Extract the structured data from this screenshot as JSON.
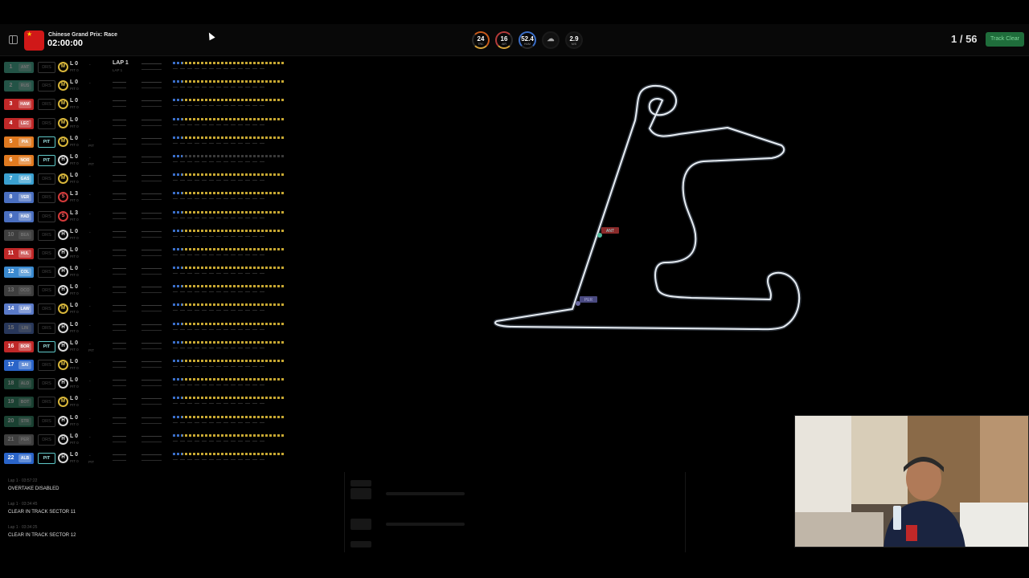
{
  "header": {
    "race_name": "Chinese Grand Prix: Race",
    "clock": "02:00:00",
    "lap_current": "1",
    "lap_total": "56",
    "lap_text": "1 / 56",
    "track_status": "Track Clear",
    "flag_icon": "china-flag-icon"
  },
  "weather": [
    {
      "value": "24",
      "label": "TRC"
    },
    {
      "value": "16",
      "label": "AIR"
    },
    {
      "value": "52.4",
      "label": "HUM"
    },
    {
      "value": "",
      "label": "RAIN",
      "icon": "rain-cloud-icon"
    },
    {
      "value": "2.9",
      "label": "M/S"
    }
  ],
  "lap_header": {
    "title": "LAP 1",
    "sub": "LAP 1"
  },
  "drivers": [
    {
      "pos": "1",
      "code": "ANT",
      "color": "#4fb89b",
      "dim": true,
      "drs": "DRS",
      "tyre": "M",
      "laps": "L 0",
      "pit": "PIT 0"
    },
    {
      "pos": "2",
      "code": "RUS",
      "color": "#4fb89b",
      "dim": true,
      "drs": "DRS",
      "tyre": "M",
      "laps": "L 0",
      "pit": "PIT 0"
    },
    {
      "pos": "3",
      "code": "HAM",
      "color": "#c02828",
      "dim": false,
      "drs": "DRS",
      "tyre": "M",
      "laps": "L 0",
      "pit": "PIT 0"
    },
    {
      "pos": "4",
      "code": "LEC",
      "color": "#c02828",
      "dim": false,
      "drs": "DRS",
      "tyre": "M",
      "laps": "L 0",
      "pit": "PIT 0"
    },
    {
      "pos": "5",
      "code": "PIA",
      "color": "#e07a20",
      "dim": false,
      "drs": "PIT",
      "tyre": "M",
      "laps": "L 0",
      "pit": "PIT 0",
      "pittag": "PIT"
    },
    {
      "pos": "6",
      "code": "NOR",
      "color": "#e07a20",
      "dim": false,
      "drs": "PIT",
      "tyre": "H",
      "laps": "L 0",
      "pit": "PIT 0",
      "pittag": "PIT"
    },
    {
      "pos": "7",
      "code": "GAS",
      "color": "#3aa0d0",
      "dim": false,
      "drs": "DRS",
      "tyre": "M",
      "laps": "L 0",
      "pit": "PIT 0"
    },
    {
      "pos": "8",
      "code": "VER",
      "color": "#4a6fc0",
      "dim": false,
      "drs": "DRS",
      "tyre": "S",
      "laps": "L 3",
      "pit": "PIT 0"
    },
    {
      "pos": "9",
      "code": "HAD",
      "color": "#4a6fc0",
      "dim": false,
      "drs": "DRS",
      "tyre": "S",
      "laps": "L 3",
      "pit": "PIT 0"
    },
    {
      "pos": "10",
      "code": "BEA",
      "color": "#8a8a8a",
      "dim": true,
      "drs": "DRS",
      "tyre": "H",
      "laps": "L 0",
      "pit": "PIT 0"
    },
    {
      "pos": "11",
      "code": "HUL",
      "color": "#c02828",
      "dim": false,
      "drs": "DRS",
      "tyre": "H",
      "laps": "L 0",
      "pit": "PIT 0"
    },
    {
      "pos": "12",
      "code": "COL",
      "color": "#3a8ad0",
      "dim": false,
      "drs": "DRS",
      "tyre": "H",
      "laps": "L 0",
      "pit": "PIT 0"
    },
    {
      "pos": "13",
      "code": "OCO",
      "color": "#8a8a8a",
      "dim": true,
      "drs": "DRS",
      "tyre": "H",
      "laps": "L 0",
      "pit": "PIT 0"
    },
    {
      "pos": "14",
      "code": "LAW",
      "color": "#5a7ac8",
      "dim": false,
      "drs": "DRS",
      "tyre": "M",
      "laps": "L 0",
      "pit": "PIT 0"
    },
    {
      "pos": "15",
      "code": "LIN",
      "color": "#5a7ac8",
      "dim": true,
      "drs": "DRS",
      "tyre": "H",
      "laps": "L 0",
      "pit": "PIT 0"
    },
    {
      "pos": "16",
      "code": "BOR",
      "color": "#c02828",
      "dim": false,
      "drs": "PIT",
      "tyre": "H",
      "laps": "L 0",
      "pit": "PIT 0",
      "pittag": "PIT"
    },
    {
      "pos": "17",
      "code": "SAI",
      "color": "#2a64c8",
      "dim": false,
      "drs": "DRS",
      "tyre": "M",
      "laps": "L 0",
      "pit": "PIT 0"
    },
    {
      "pos": "18",
      "code": "ALO",
      "color": "#3a9070",
      "dim": true,
      "drs": "DRS",
      "tyre": "H",
      "laps": "L 0",
      "pit": "PIT 0"
    },
    {
      "pos": "19",
      "code": "BOT",
      "color": "#3a9070",
      "dim": true,
      "drs": "DRS",
      "tyre": "M",
      "laps": "L 0",
      "pit": "PIT 0"
    },
    {
      "pos": "20",
      "code": "STR",
      "color": "#3a9070",
      "dim": true,
      "drs": "DRS",
      "tyre": "H",
      "laps": "L 0",
      "pit": "PIT 0"
    },
    {
      "pos": "21",
      "code": "PER",
      "color": "#8a8a8a",
      "dim": true,
      "drs": "DRS",
      "tyre": "H",
      "laps": "L 0",
      "pit": "PIT 0"
    },
    {
      "pos": "22",
      "code": "ALB",
      "color": "#2a64c8",
      "dim": false,
      "drs": "PIT",
      "tyre": "H",
      "laps": "L 0",
      "pit": "PIT 0",
      "pittag": "PIT"
    }
  ],
  "race_control": [
    {
      "time": "Lap 1 · 03:57:22",
      "message": "OVERTAKE DISABLED"
    },
    {
      "time": "Lap 1 · 03:34:45",
      "message": "CLEAR IN TRACK SECTOR 11"
    },
    {
      "time": "Lap 1 · 03:34:25",
      "message": "CLEAR IN TRACK SECTOR 12"
    }
  ],
  "map_markers": [
    {
      "label": "ANT"
    },
    {
      "label": "PER"
    }
  ]
}
